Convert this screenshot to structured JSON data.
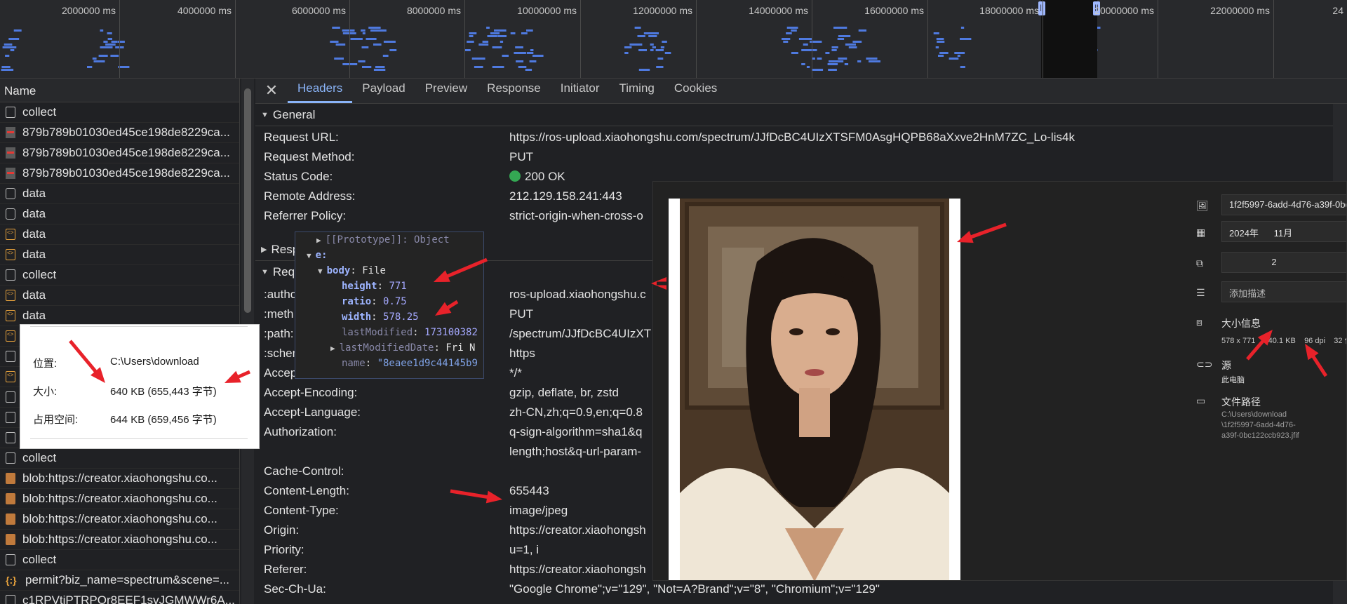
{
  "timeline": {
    "ticks": [
      "2000000 ms",
      "4000000 ms",
      "6000000 ms",
      "8000000 ms",
      "10000000 ms",
      "12000000 ms",
      "14000000 ms",
      "16000000 ms",
      "18000000 ms",
      "20000000 ms",
      "22000000 ms",
      "24"
    ]
  },
  "namelist": {
    "header": "Name",
    "rows": [
      {
        "icon": "doc",
        "text": "collect"
      },
      {
        "icon": "img",
        "text": "879b789b01030ed45ce198de8229ca..."
      },
      {
        "icon": "img",
        "text": "879b789b01030ed45ce198de8229ca..."
      },
      {
        "icon": "img",
        "text": "879b789b01030ed45ce198de8229ca..."
      },
      {
        "icon": "chk",
        "text": "data"
      },
      {
        "icon": "chk",
        "text": "data"
      },
      {
        "icon": "xhr",
        "text": "data"
      },
      {
        "icon": "xhr",
        "text": "data"
      },
      {
        "icon": "doc",
        "text": "collect"
      },
      {
        "icon": "xhr",
        "text": "data"
      },
      {
        "icon": "xhr",
        "text": "data"
      },
      {
        "icon": "xhr",
        "text": ""
      },
      {
        "icon": "doc",
        "text": ""
      },
      {
        "icon": "xhr",
        "text": ""
      },
      {
        "icon": "doc",
        "text": ""
      },
      {
        "icon": "doc",
        "text": ""
      },
      {
        "icon": "doc",
        "text": ""
      },
      {
        "icon": "doc",
        "text": "collect"
      },
      {
        "icon": "blob",
        "text": "blob:https://creator.xiaohongshu.co..."
      },
      {
        "icon": "blob",
        "text": "blob:https://creator.xiaohongshu.co..."
      },
      {
        "icon": "blob",
        "text": "blob:https://creator.xiaohongshu.co..."
      },
      {
        "icon": "blob",
        "text": "blob:https://creator.xiaohongshu.co..."
      },
      {
        "icon": "doc",
        "text": "collect"
      },
      {
        "icon": "json",
        "text": "permit?biz_name=spectrum&scene=..."
      },
      {
        "icon": "doc",
        "text": "c1RPVtiPTRPOr8EEF1svJGMWWr6A..."
      }
    ]
  },
  "tabs": [
    "Headers",
    "Payload",
    "Preview",
    "Response",
    "Initiator",
    "Timing",
    "Cookies"
  ],
  "sections": {
    "general": "General",
    "response": "Resp",
    "request": "Requ"
  },
  "general": [
    {
      "k": "Request URL:",
      "v": "https://ros-upload.xiaohongshu.com/spectrum/JJfDcBC4UIzXTSFM0AsgHQPB68aXxve2HnM7ZC_Lo-lis4k"
    },
    {
      "k": "Request Method:",
      "v": "PUT"
    },
    {
      "k": "Status Code:",
      "v": "200 OK"
    },
    {
      "k": "Remote Address:",
      "v": "212.129.158.241:443"
    },
    {
      "k": "Referrer Policy:",
      "v": "strict-origin-when-cross-o"
    }
  ],
  "request_headers": [
    {
      "k": ":autho",
      "v": "ros-upload.xiaohongshu.c"
    },
    {
      "k": ":meth",
      "v": "PUT"
    },
    {
      "k": ":path:",
      "v": "/spectrum/JJfDcBC4UIzXT"
    },
    {
      "k": ":schem",
      "v": "https"
    },
    {
      "k": "Accept:",
      "v": "*/*"
    },
    {
      "k": "Accept-Encoding:",
      "v": "gzip, deflate, br, zstd"
    },
    {
      "k": "Accept-Language:",
      "v": "zh-CN,zh;q=0.9,en;q=0.8"
    },
    {
      "k": "Authorization:",
      "v": "q-sign-algorithm=sha1&q"
    },
    {
      "k": "",
      "v": "length;host&q-url-param-"
    },
    {
      "k": "Cache-Control:",
      "v": ""
    },
    {
      "k": "Content-Length:",
      "v": "655443"
    },
    {
      "k": "Content-Type:",
      "v": "image/jpeg"
    },
    {
      "k": "Origin:",
      "v": "https://creator.xiaohongsh"
    },
    {
      "k": "Priority:",
      "v": "u=1, i"
    },
    {
      "k": "Referer:",
      "v": "https://creator.xiaohongsh"
    },
    {
      "k": "Sec-Ch-Ua:",
      "v": "\"Google Chrome\";v=\"129\", \"Not=A?Brand\";v=\"8\", \"Chromium\";v=\"129\""
    }
  ],
  "objtip": {
    "proto": "[[Prototype]]: Object",
    "e": "e:",
    "body_key": "body",
    "body_type": "File",
    "height_key": "height",
    "height": "771",
    "ratio_key": "ratio",
    "ratio": "0.75",
    "width_key": "width",
    "width": "578.25",
    "lastmod_key": "lastModified",
    "lastmod": "173100382",
    "lastmoddate_key": "lastModifiedDate",
    "lastmoddate": "Fri N",
    "name_key": "name",
    "name": "\"8eaee1d9c44145b9",
    "size_key": "size",
    "size": "655443"
  },
  "props": {
    "location_label": "位置:",
    "location": "C:\\Users\\download",
    "size_label": "大小:",
    "size": "640 KB (655,443 字节)",
    "disk_label": "占用空间:",
    "disk": "644 KB (659,456 字节)"
  },
  "viewer": {
    "filename": "1f2f5997-6add-4d76-a39f-0bc",
    "year": "2024年",
    "month": "11月",
    "rating": "2",
    "desc_placeholder": "添加描述",
    "size_title": "大小信息",
    "dims": "578 x 771",
    "filesize": "640.1 KB",
    "dpi": "96 dpi",
    "bits": "32 位",
    "source_title": "源",
    "source": "此电脑",
    "path_title": "文件路径",
    "path_line1": "C:\\Users\\download",
    "path_line2": "\\1f2f5997-6add-4d76-",
    "path_line3": "a39f-0bc122ccb923.jfif"
  },
  "colors": {
    "accent": "#8ab4f8",
    "status_ok": "#34a853",
    "arrow": "#e8222a",
    "bars": "#4f7ae0"
  }
}
